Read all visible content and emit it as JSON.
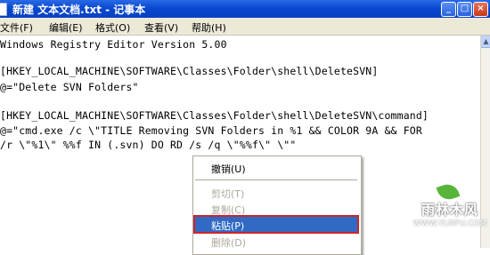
{
  "window": {
    "title": "新建 文本文档.txt - 记事本",
    "minimize_glyph": "_",
    "maximize_glyph": "□",
    "close_glyph": "×"
  },
  "menubar": {
    "items": [
      "文件(F)",
      "编辑(E)",
      "格式(O)",
      "查看(V)",
      "帮助(H)"
    ]
  },
  "editor": {
    "lines": [
      "Windows Registry Editor Version 5.00",
      "",
      "[HKEY_LOCAL_MACHINE\\SOFTWARE\\Classes\\Folder\\shell\\DeleteSVN]",
      "@=\"Delete SVN Folders\"",
      "",
      "[HKEY_LOCAL_MACHINE\\SOFTWARE\\Classes\\Folder\\shell\\DeleteSVN\\command]",
      "@=\"cmd.exe /c \\\"TITLE Removing SVN Folders in %1 && COLOR 9A && FOR",
      "/r \\\"%1\\\" %%f IN (.svn) DO RD /s /q \\\"%%f\\\" \\\"\""
    ]
  },
  "context_menu": {
    "items": [
      {
        "label": "撤销(U)",
        "enabled": true
      },
      {
        "label": "剪切(T)",
        "enabled": false
      },
      {
        "label": "复制(C)",
        "enabled": false
      },
      {
        "label": "粘贴(P)",
        "enabled": true,
        "selected": true
      },
      {
        "label": "删除(D)",
        "enabled": false
      }
    ]
  },
  "watermark": {
    "brand": "雨林木风",
    "url": "WWW.YLMFU.COM"
  },
  "hint_glyph": "T",
  "scroll_up_glyph": "▲",
  "colors": {
    "titlebar": "#0a48cf",
    "menubar": "#ece9d8",
    "selection": "#316ac5",
    "highlight_box": "#d0232a"
  }
}
